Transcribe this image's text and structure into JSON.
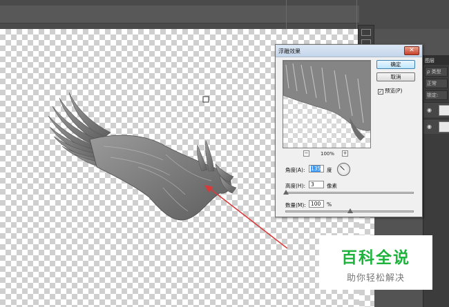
{
  "dialog": {
    "title": "浮雕效果",
    "close_label": "✕",
    "ok_label": "确定",
    "cancel_label": "取消",
    "preview_checkbox_label": "预览(P)",
    "preview_checked": true,
    "zoom_out": "−",
    "zoom_in": "+",
    "zoom_value": "100%",
    "angle_label": "角度(A):",
    "angle_value": "135",
    "angle_unit": "度",
    "height_label": "高度(H):",
    "height_value": "3",
    "height_unit": "像素",
    "amount_label": "数量(M):",
    "amount_value": "100",
    "amount_unit": "%",
    "height_slider_fraction": 0.0,
    "amount_slider_fraction": 0.5
  },
  "layers_panel": {
    "tab_label": "图层",
    "search_label": "ρ 类型",
    "blend_mode": "正常",
    "lock_label": "锁定:"
  },
  "watermark": {
    "title": "百科全说",
    "subtitle": "助你轻松解决"
  },
  "colors": {
    "arrow": "#d83a3a",
    "watermark_green": "#1db33d"
  }
}
